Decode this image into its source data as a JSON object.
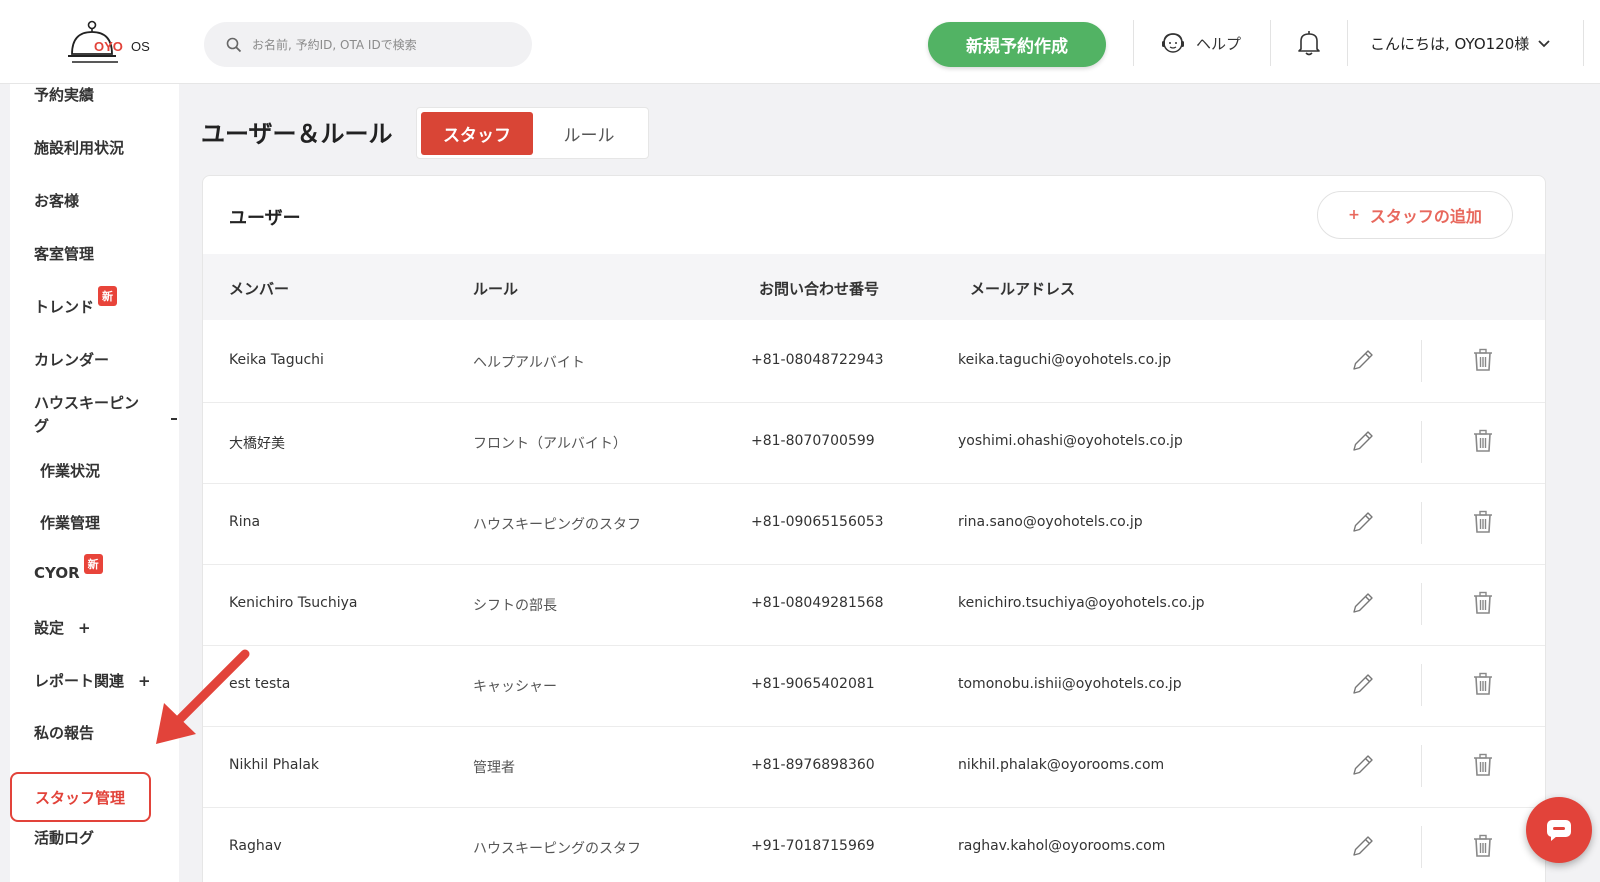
{
  "header": {
    "logo_text": "OYO OS",
    "search_placeholder": "お名前, 予約ID, OTA IDで検索",
    "new_reservation": "新規予約作成",
    "help": "ヘルプ",
    "greeting": "こんにちは, OYO120様"
  },
  "sidebar": {
    "items": [
      {
        "label": "予約実績"
      },
      {
        "label": "施設利用状況"
      },
      {
        "label": "お客様"
      },
      {
        "label": "客室管理"
      },
      {
        "label": "トレンド",
        "badge": "新"
      },
      {
        "label": "カレンダー"
      },
      {
        "label": "ハウスキーピン",
        "label2": "グ"
      },
      {
        "label": "作業状況"
      },
      {
        "label": "作業管理"
      },
      {
        "label": "CYOR",
        "badge": "新"
      },
      {
        "label": "設定",
        "plus": "+"
      },
      {
        "label": "レポート関連",
        "plus": "+"
      },
      {
        "label": "私の報告"
      },
      {
        "label": "スタッフ管理"
      },
      {
        "label": "活動ログ"
      }
    ]
  },
  "page": {
    "title": "ユーザー＆ルール",
    "tabs": [
      "スタッフ",
      "ルール"
    ]
  },
  "card": {
    "title": "ユーザー",
    "add_staff": "スタッフの追加",
    "add_plus": "+",
    "columns": [
      "メンバー",
      "ルール",
      "お問い合わせ番号",
      "メールアドレス"
    ],
    "rows": [
      {
        "member": "Keika Taguchi",
        "role": "ヘルプアルバイト",
        "phone": "+81-08048722943",
        "email": "keika.taguchi@oyohotels.co.jp"
      },
      {
        "member": "大橋好美",
        "role": "フロント（アルバイト）",
        "phone": "+81-8070700599",
        "email": "yoshimi.ohashi@oyohotels.co.jp"
      },
      {
        "member": "Rina",
        "role": "ハウスキーピングのスタフ",
        "phone": "+81-09065156053",
        "email": "rina.sano@oyohotels.co.jp"
      },
      {
        "member": "Kenichiro Tsuchiya",
        "role": "シフトの部長",
        "phone": "+81-08049281568",
        "email": "kenichiro.tsuchiya@oyohotels.co.jp"
      },
      {
        "member": "est testa",
        "role": "キャッシャー",
        "phone": "+81-9065402081",
        "email": "tomonobu.ishii@oyohotels.co.jp"
      },
      {
        "member": "Nikhil Phalak",
        "role": "管理者",
        "phone": "+81-8976898360",
        "email": "nikhil.phalak@oyorooms.com"
      },
      {
        "member": "Raghav",
        "role": "ハウスキーピングのスタフ",
        "phone": "+91-7018715969",
        "email": "raghav.kahol@oyorooms.com"
      }
    ]
  },
  "colors": {
    "brand_red": "#e2433a",
    "green": "#52b364",
    "add_text": "#e8685d"
  }
}
